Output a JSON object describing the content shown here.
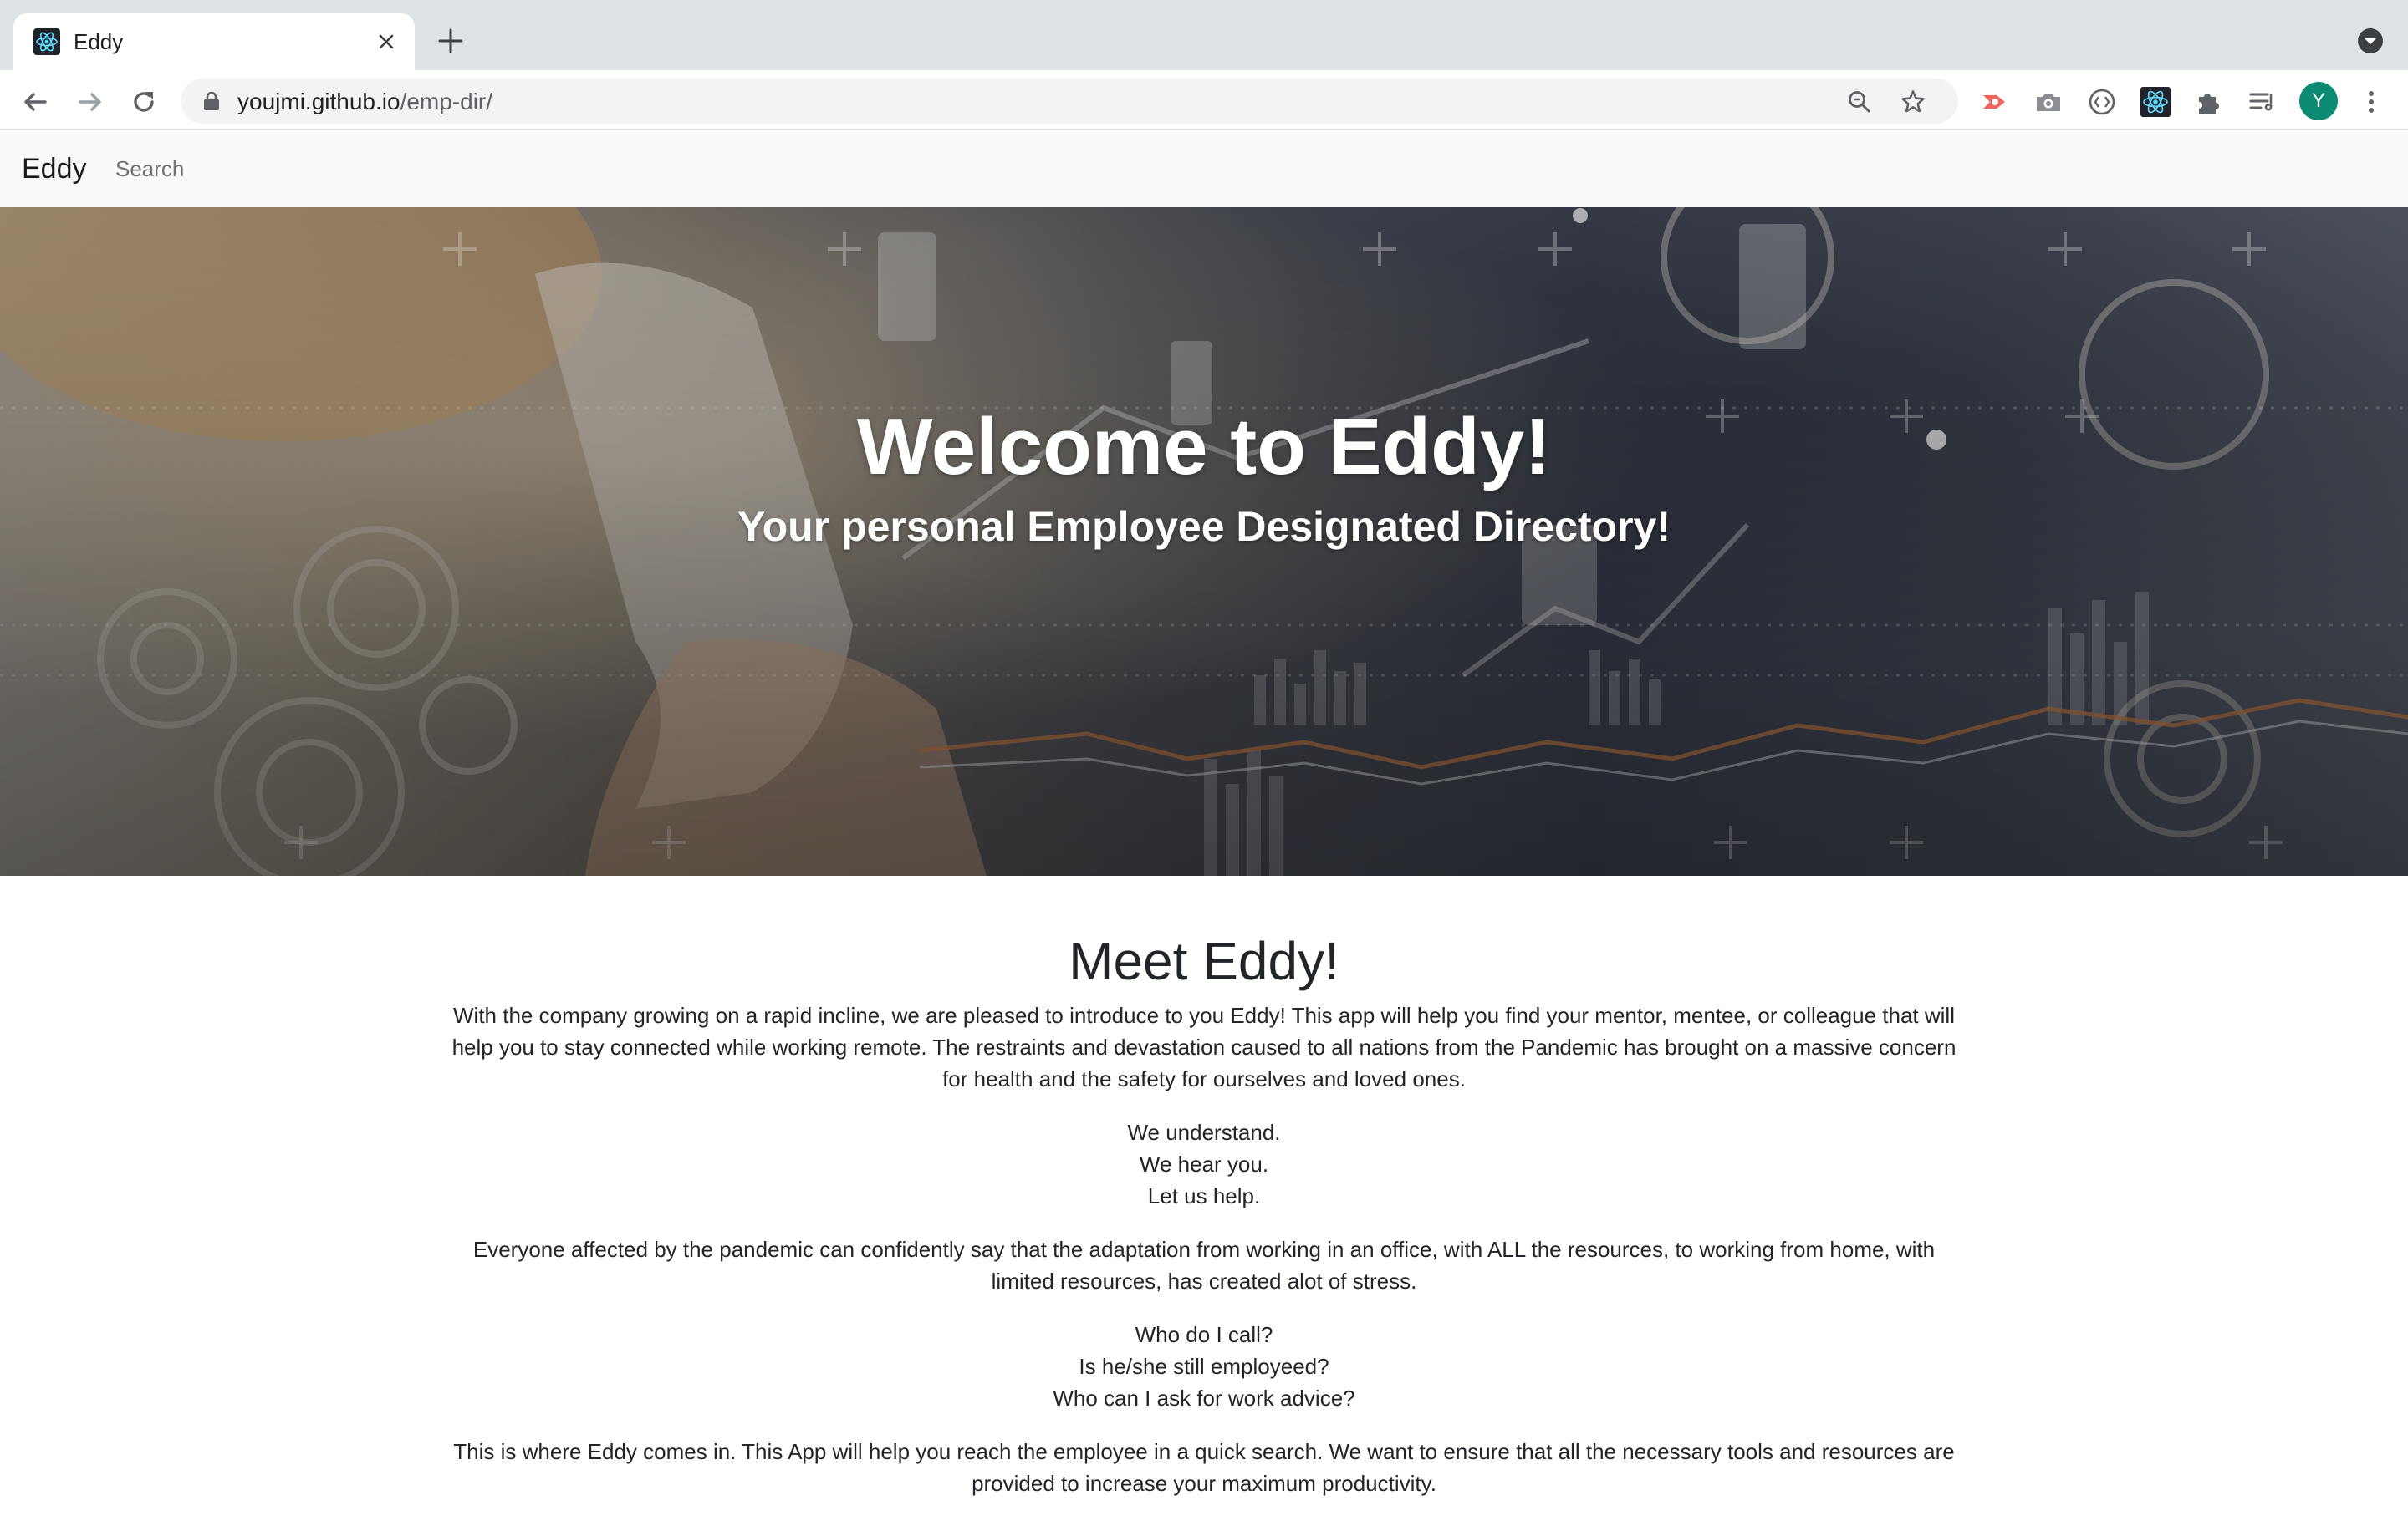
{
  "browser": {
    "tab_title": "Eddy",
    "url_host": "youjmi.github.io",
    "url_path": "/emp-dir/",
    "profile_initial": "Y"
  },
  "navbar": {
    "brand": "Eddy",
    "search_link": "Search"
  },
  "hero": {
    "title": "Welcome to Eddy!",
    "subtitle": "Your personal Employee Designated Directory!"
  },
  "content": {
    "heading": "Meet Eddy!",
    "intro": "With the company growing on a rapid incline, we are pleased to introduce to you Eddy! This app will help you find your mentor, mentee, or colleague that will help you to stay connected while working remote. The restraints and devastation caused to all nations from the Pandemic has brought on a massive concern for health and the safety for ourselves and loved ones.",
    "reassure": [
      "We understand.",
      "We hear you.",
      "Let us help."
    ],
    "adaptation": "Everyone affected by the pandemic can confidently say that the adaptation from working in an office, with ALL the resources, to working from home, with limited resources, has created alot of stress.",
    "questions": [
      "Who do I call?",
      "Is he/she still employeed?",
      "Who can I ask for work advice?"
    ],
    "closing": "This is where Eddy comes in. This App will help you reach the employee in a quick search. We want to ensure that all the necessary tools and resources are provided to increase your maximum productivity."
  },
  "colors": {
    "tabstrip": "#dee1e6",
    "omnibox": "#f1f3f4",
    "navbar": "#f8f9fa",
    "avatar": "#0d8a72",
    "react": "#61dafb",
    "ext_red": "#f0655b"
  },
  "icons": [
    "react-icon",
    "close-icon",
    "plus-icon",
    "chevron-down-icon",
    "back-icon",
    "forward-icon",
    "reload-icon",
    "lock-icon",
    "zoom-icon",
    "star-icon",
    "camera-icon",
    "extensions-icon",
    "reading-list-icon",
    "menu-icon"
  ]
}
